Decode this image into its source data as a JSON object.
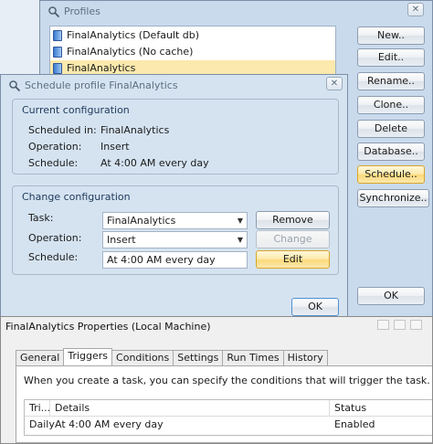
{
  "profiles_window": {
    "title": "Profiles",
    "close": "✕",
    "list": [
      {
        "label": "FinalAnalytics (Default db)",
        "selected": false
      },
      {
        "label": "FinalAnalytics (No cache)",
        "selected": false
      },
      {
        "label": "FinalAnalytics",
        "selected": true
      }
    ],
    "buttons": {
      "new": "New..",
      "edit": "Edit..",
      "rename": "Rename..",
      "clone": "Clone..",
      "delete": "Delete",
      "database": "Database..",
      "schedule": "Schedule..",
      "synchronize": "Synchronize..",
      "ok": "OK"
    }
  },
  "schedule_window": {
    "title": "Schedule profile FinalAnalytics",
    "close": "✕",
    "current": {
      "title": "Current configuration",
      "scheduled_in_label": "Scheduled in:",
      "scheduled_in_value": "FinalAnalytics",
      "operation_label": "Operation:",
      "operation_value": "Insert",
      "schedule_label": "Schedule:",
      "schedule_value": "At 4:00 AM every day"
    },
    "change": {
      "title": "Change configuration",
      "task_label": "Task:",
      "task_value": "FinalAnalytics",
      "operation_label": "Operation:",
      "operation_value": "Insert",
      "schedule_label": "Schedule:",
      "schedule_value": "At 4:00 AM every day",
      "remove_button": "Remove",
      "change_button": "Change",
      "edit_button": "Edit"
    },
    "ok_button": "OK"
  },
  "properties_window": {
    "title": "FinalAnalytics Properties (Local Machine)",
    "tabs": [
      "General",
      "Triggers",
      "Conditions",
      "Settings",
      "Run Times",
      "History"
    ],
    "active_tab": "Triggers",
    "description": "When you create a task, you can specify the conditions that will trigger the task.",
    "columns": [
      "Tri...",
      "Details",
      "Status"
    ],
    "rows": [
      {
        "trigger": "Daily",
        "details": "At 4:00 AM every day",
        "status": "Enabled"
      }
    ]
  },
  "colors": {
    "accent_selection": "#fbe9ad",
    "window_blue": "#d5e3f1",
    "highlight_button": "#fbd97a"
  },
  "icons": {
    "title_icon": "magnifier-icon",
    "list_icon": "database-icon",
    "dropdown_icon": "chevron-down-icon"
  }
}
